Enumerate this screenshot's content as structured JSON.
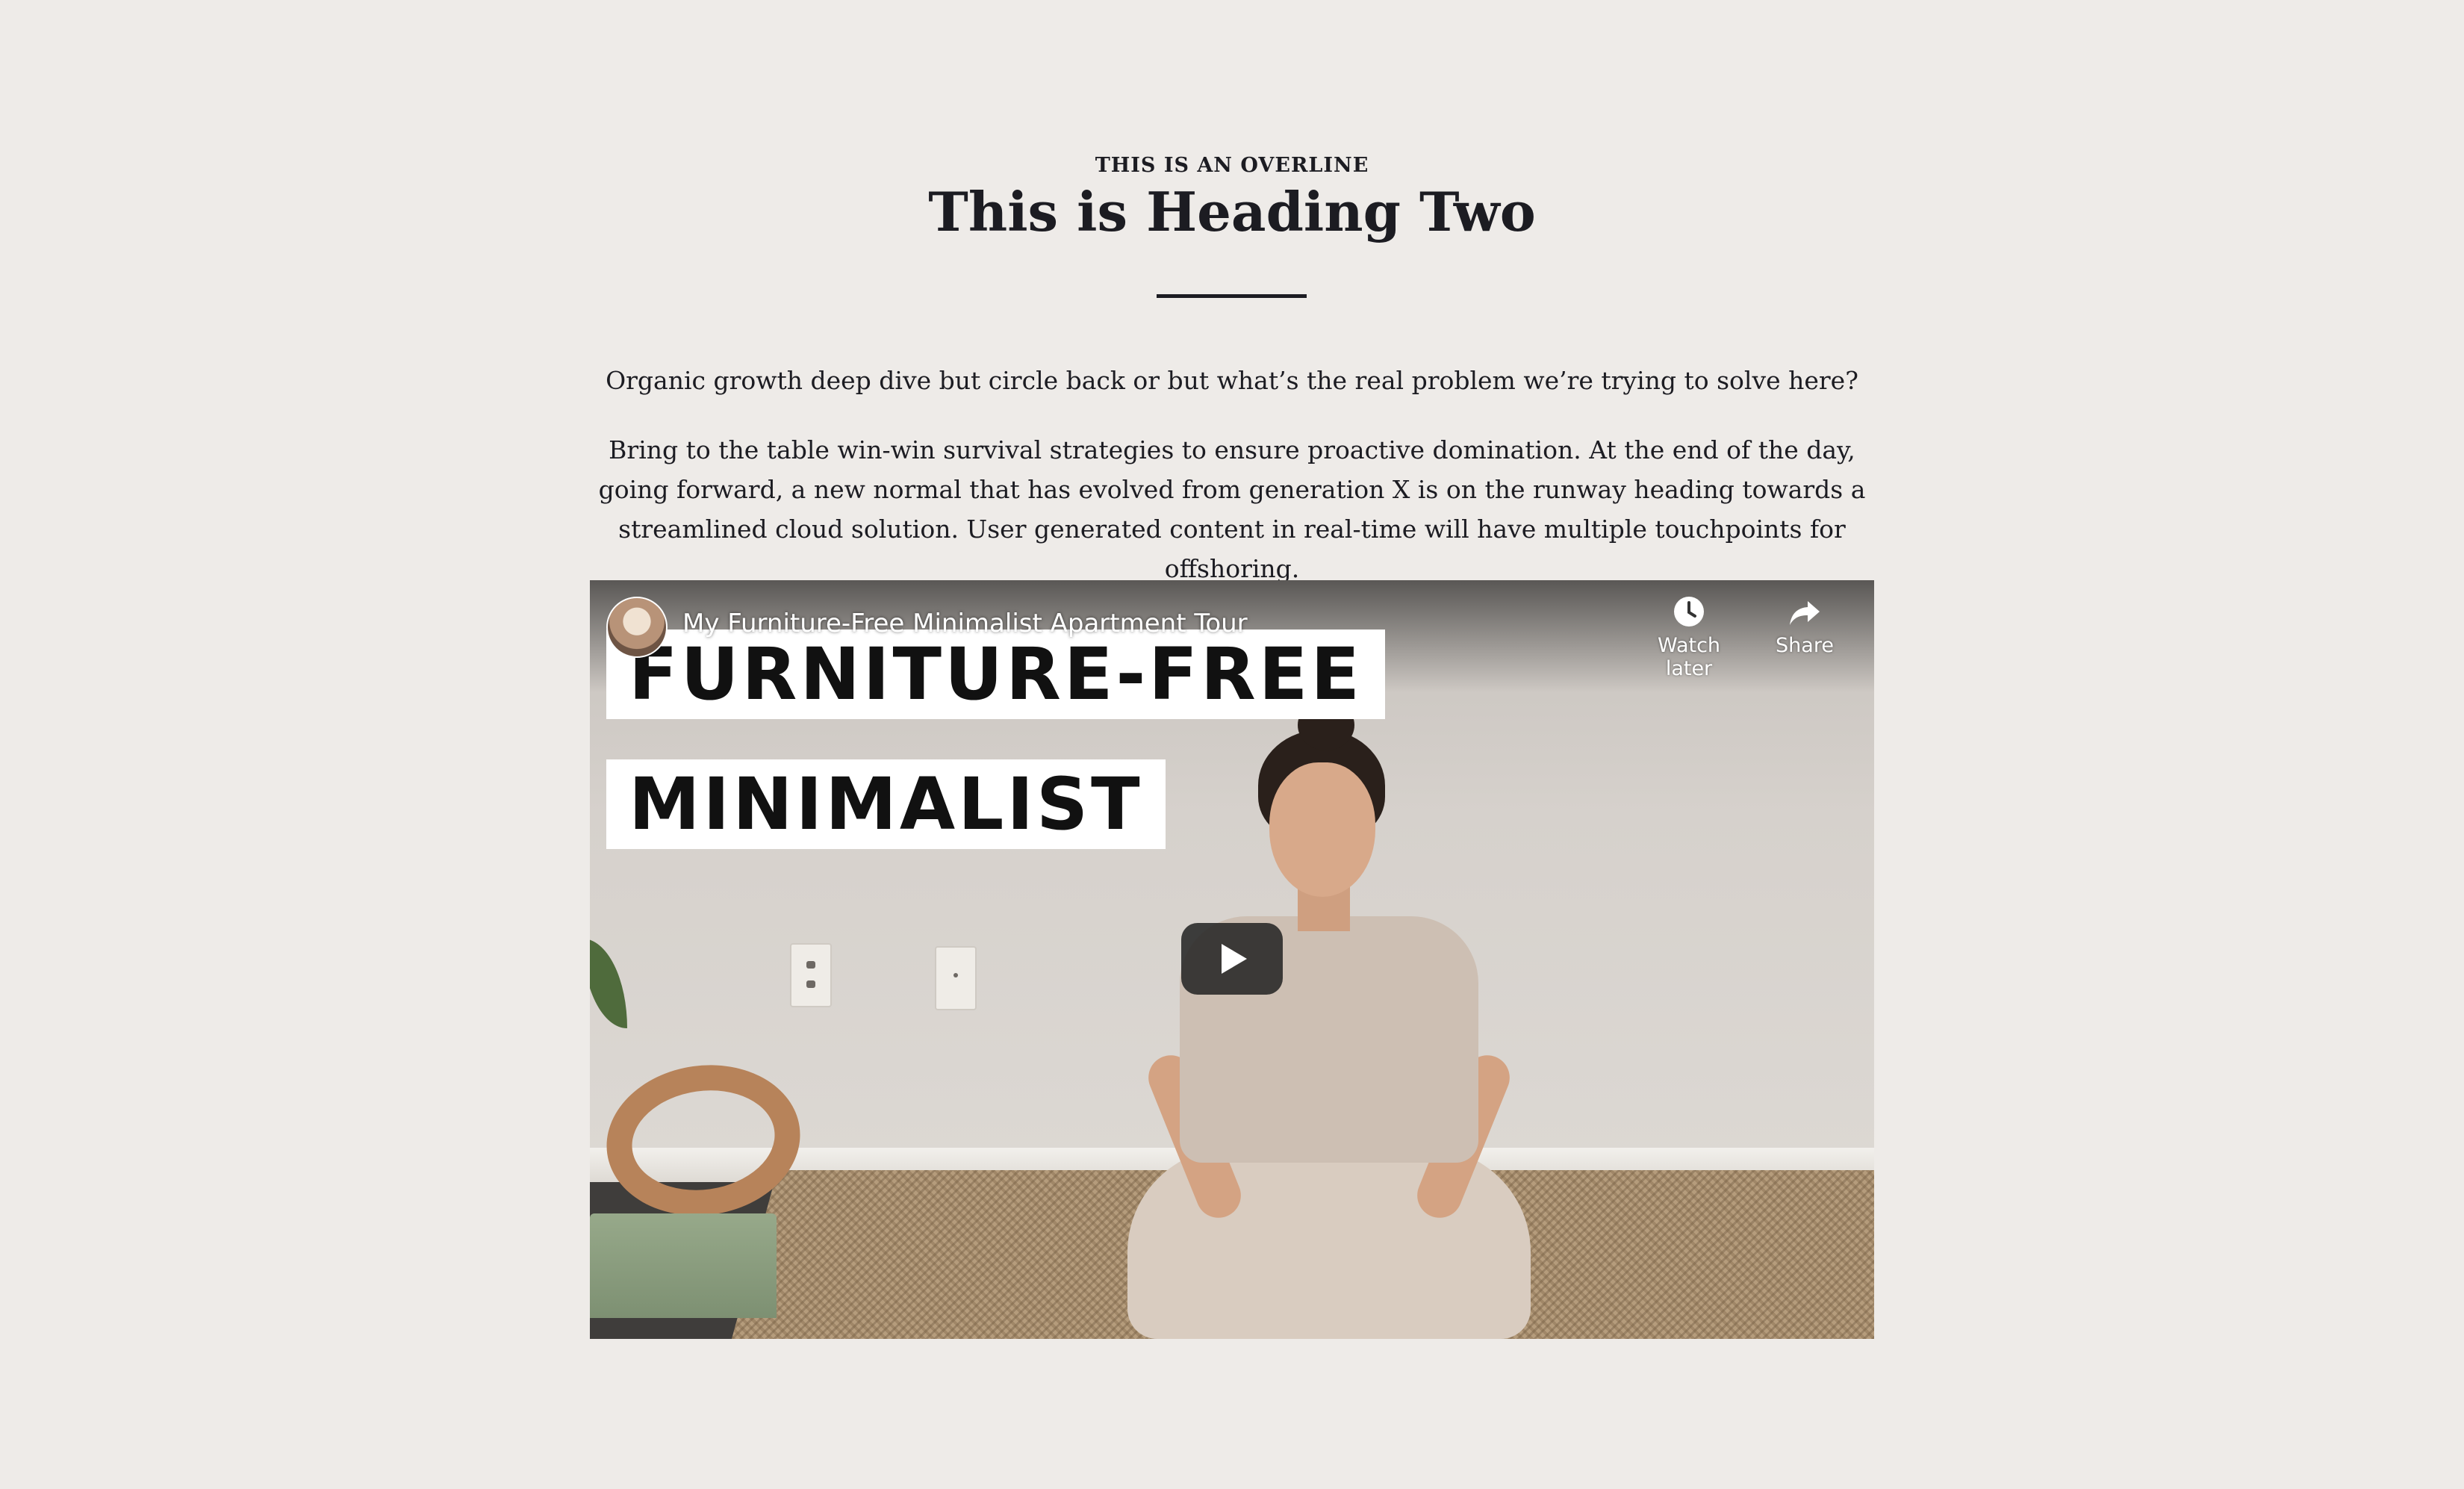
{
  "section": {
    "overline": "THIS IS AN OVERLINE",
    "heading": "This is Heading Two",
    "paragraphs": [
      "Organic growth deep dive but circle back or but what’s the real problem we’re trying to solve here?",
      "Bring to the table win-win survival strategies to ensure proactive domination. At the end of the day, going forward, a new normal that has evolved from generation X is on the runway heading towards a streamlined cloud solution. User generated content in real-time will have multiple touchpoints for offshoring."
    ]
  },
  "video": {
    "title": "My Furniture-Free Minimalist Apartment Tour",
    "thumbnail_text": [
      "FURNITURE-FREE",
      "MINIMALIST"
    ],
    "actions": {
      "watch_later": "Watch later",
      "share": "Share"
    },
    "icons": {
      "watch_later": "clock-icon",
      "share": "share-arrow-icon",
      "play": "play-icon"
    }
  },
  "colors": {
    "background": "#eeebe8",
    "text": "#1c1c22",
    "play_button": "#212121"
  }
}
